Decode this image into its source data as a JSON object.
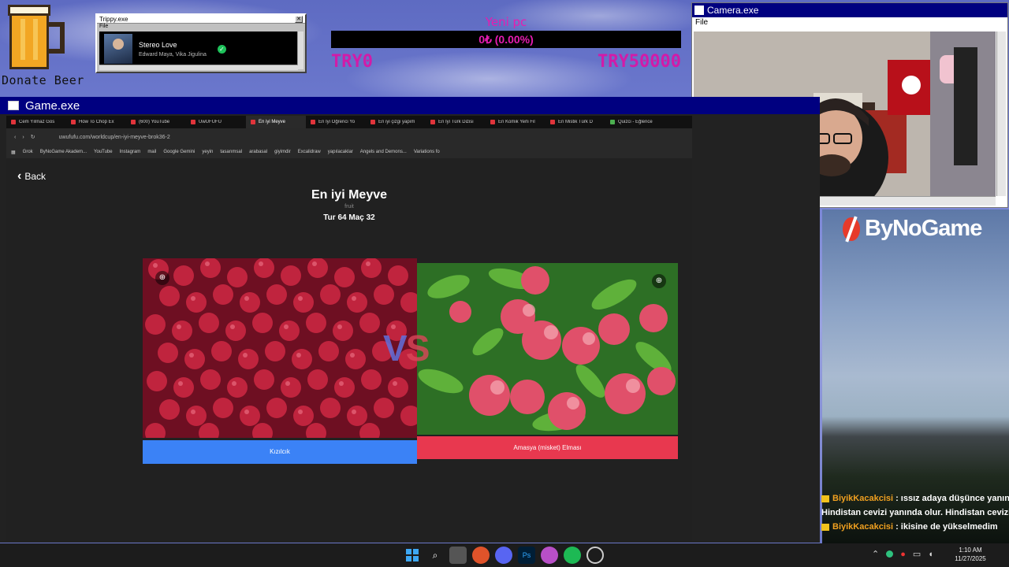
{
  "donate": {
    "text": "Donate Beer"
  },
  "trippy": {
    "title": "Trippy.exe",
    "menu": "File",
    "song_title": "Stereo Love",
    "song_artist": "Edward Maya, Vika Jigulina"
  },
  "goal": {
    "title": "Yeni pc",
    "progress_text": "0₺ (0.00%)",
    "progress": 0.0,
    "min": "TRY0",
    "max": "TRY50000"
  },
  "camera": {
    "title": "Camera.exe",
    "menu": "File"
  },
  "game": {
    "title": "Game.exe",
    "tabs": [
      "Cem Yılmaz Gos",
      "How To Chop Ex",
      "(600) YouTube",
      "UwUFUFU",
      "En iyi Meyve",
      "En İyi Öğrenci Yo",
      "En iyi çizgi yapım",
      "En İyi Türk Dizisi",
      "En Komik Yerli Fil",
      "En Mistik Türk D",
      "Quizci - Eğlence"
    ],
    "active_tab": 4,
    "url": "uwufufu.com/worldcup/en-iyi-meyve-brok36-2",
    "bookmarks": [
      "Grok",
      "ByNoGame Akadem...",
      "YouTube",
      "Instagram",
      "mail",
      "Google Gemini",
      "yeyin",
      "tasarımsal",
      "arabasal",
      "giyimdir",
      "Excalidraw",
      "yapılacaklar",
      "Angels and Demons...",
      "Variations fo"
    ],
    "page": {
      "back_label": "Back",
      "title": "En iyi Meyve",
      "category": "fruit",
      "round": "Tur 64 Maç 32",
      "vs_v": "V",
      "vs_s": "S",
      "left_choice": "Kızılcık",
      "right_choice": "Amasya (misket) Elması"
    }
  },
  "brand": {
    "name": "ByNoGame"
  },
  "chat": [
    {
      "user": "BiyikKacakcisi",
      "text": ": ıssız adaya düşünce yanına"
    },
    {
      "user": "",
      "text": "Hindistan cevizi yanında olur. Hindistan cevizi s"
    },
    {
      "user": "BiyikKacakcisi",
      "text": ": ikisine de yükselmedim"
    }
  ],
  "clock": {
    "time": "1:10 AM",
    "date": "11/27/2025"
  },
  "colors": {
    "goal_pink": "#e61cb1",
    "left_button": "#3b82f6",
    "right_button": "#e8384f",
    "title_bar": "#000080"
  }
}
